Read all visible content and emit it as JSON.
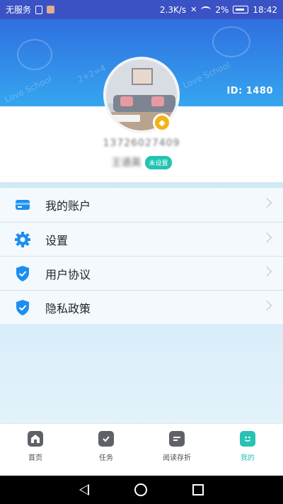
{
  "status_bar": {
    "carrier": "无服务",
    "speed": "2.3K/s",
    "battery": "2%",
    "time": "18:42"
  },
  "header": {
    "id_label": "ID: 1480",
    "doodle_text_1": "Love School",
    "doodle_text_2": "2+2=4",
    "doodle_text_3": "Love School"
  },
  "profile": {
    "phone": "13726027409",
    "name": "王语英",
    "tag": "未设置"
  },
  "menu": {
    "items": [
      {
        "label": "我的账户",
        "icon": "wallet-card-icon"
      },
      {
        "label": "设置",
        "icon": "gear-icon"
      },
      {
        "label": "用户协议",
        "icon": "shield-check-icon"
      },
      {
        "label": "隐私政策",
        "icon": "shield-check-icon"
      }
    ]
  },
  "bottom_nav": {
    "items": [
      {
        "label": "首页",
        "icon": "home-icon"
      },
      {
        "label": "任务",
        "icon": "task-calendar-icon"
      },
      {
        "label": "阅读存折",
        "icon": "passbook-icon"
      },
      {
        "label": "我的",
        "icon": "profile-face-icon",
        "active": true
      }
    ]
  },
  "colors": {
    "header_top": "#2f6fe0",
    "header_bottom": "#35a6ef",
    "accent_teal": "#26c2b3",
    "menu_icon_blue": "#1d8ef0",
    "vip_gold": "#f2b316"
  }
}
